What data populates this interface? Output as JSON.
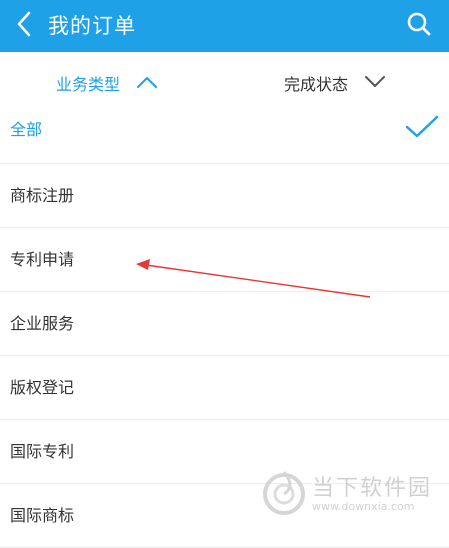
{
  "header": {
    "title": "我的订单",
    "back_icon": "chevron-left-icon",
    "search_icon": "search-icon",
    "background_color": "#1ea1e6"
  },
  "filters": {
    "business_type": {
      "label": "业务类型",
      "expanded": true,
      "icon": "chevron-up-icon"
    },
    "completion_status": {
      "label": "完成状态",
      "expanded": false,
      "icon": "chevron-down-icon"
    },
    "accent_color": "#1ea1e6"
  },
  "options": [
    {
      "label": "全部",
      "selected": true
    },
    {
      "label": "商标注册",
      "selected": false
    },
    {
      "label": "专利申请",
      "selected": false
    },
    {
      "label": "企业服务",
      "selected": false
    },
    {
      "label": "版权登记",
      "selected": false
    },
    {
      "label": "国际专利",
      "selected": false
    },
    {
      "label": "国际商标",
      "selected": false
    }
  ],
  "annotation": {
    "arrow_color": "#e53935"
  },
  "watermark": {
    "name": "当下软件园",
    "url": "www.downxia.com"
  }
}
